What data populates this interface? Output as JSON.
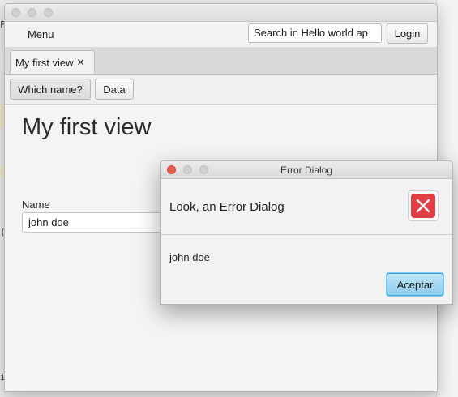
{
  "app": {
    "menu_label": "Menu",
    "search_value": "Search in Hello world ap",
    "login_label": "Login"
  },
  "tabs": [
    {
      "label": "My first view"
    }
  ],
  "toolbar": {
    "which_name_label": "Which name?",
    "data_label": "Data"
  },
  "view": {
    "title": "My first view",
    "name_label": "Name",
    "name_value": "john doe"
  },
  "dialog": {
    "title": "Error Dialog",
    "header": "Look, an Error Dialog",
    "content": "john doe",
    "accept_label": "Aceptar",
    "error_icon": "error-x-icon"
  },
  "background": {
    "char_top": "F",
    "char_mid": "(",
    "char_bottom": "i"
  },
  "colors": {
    "error_red": "#e03d44",
    "accept_blue": "#8fcdee"
  }
}
